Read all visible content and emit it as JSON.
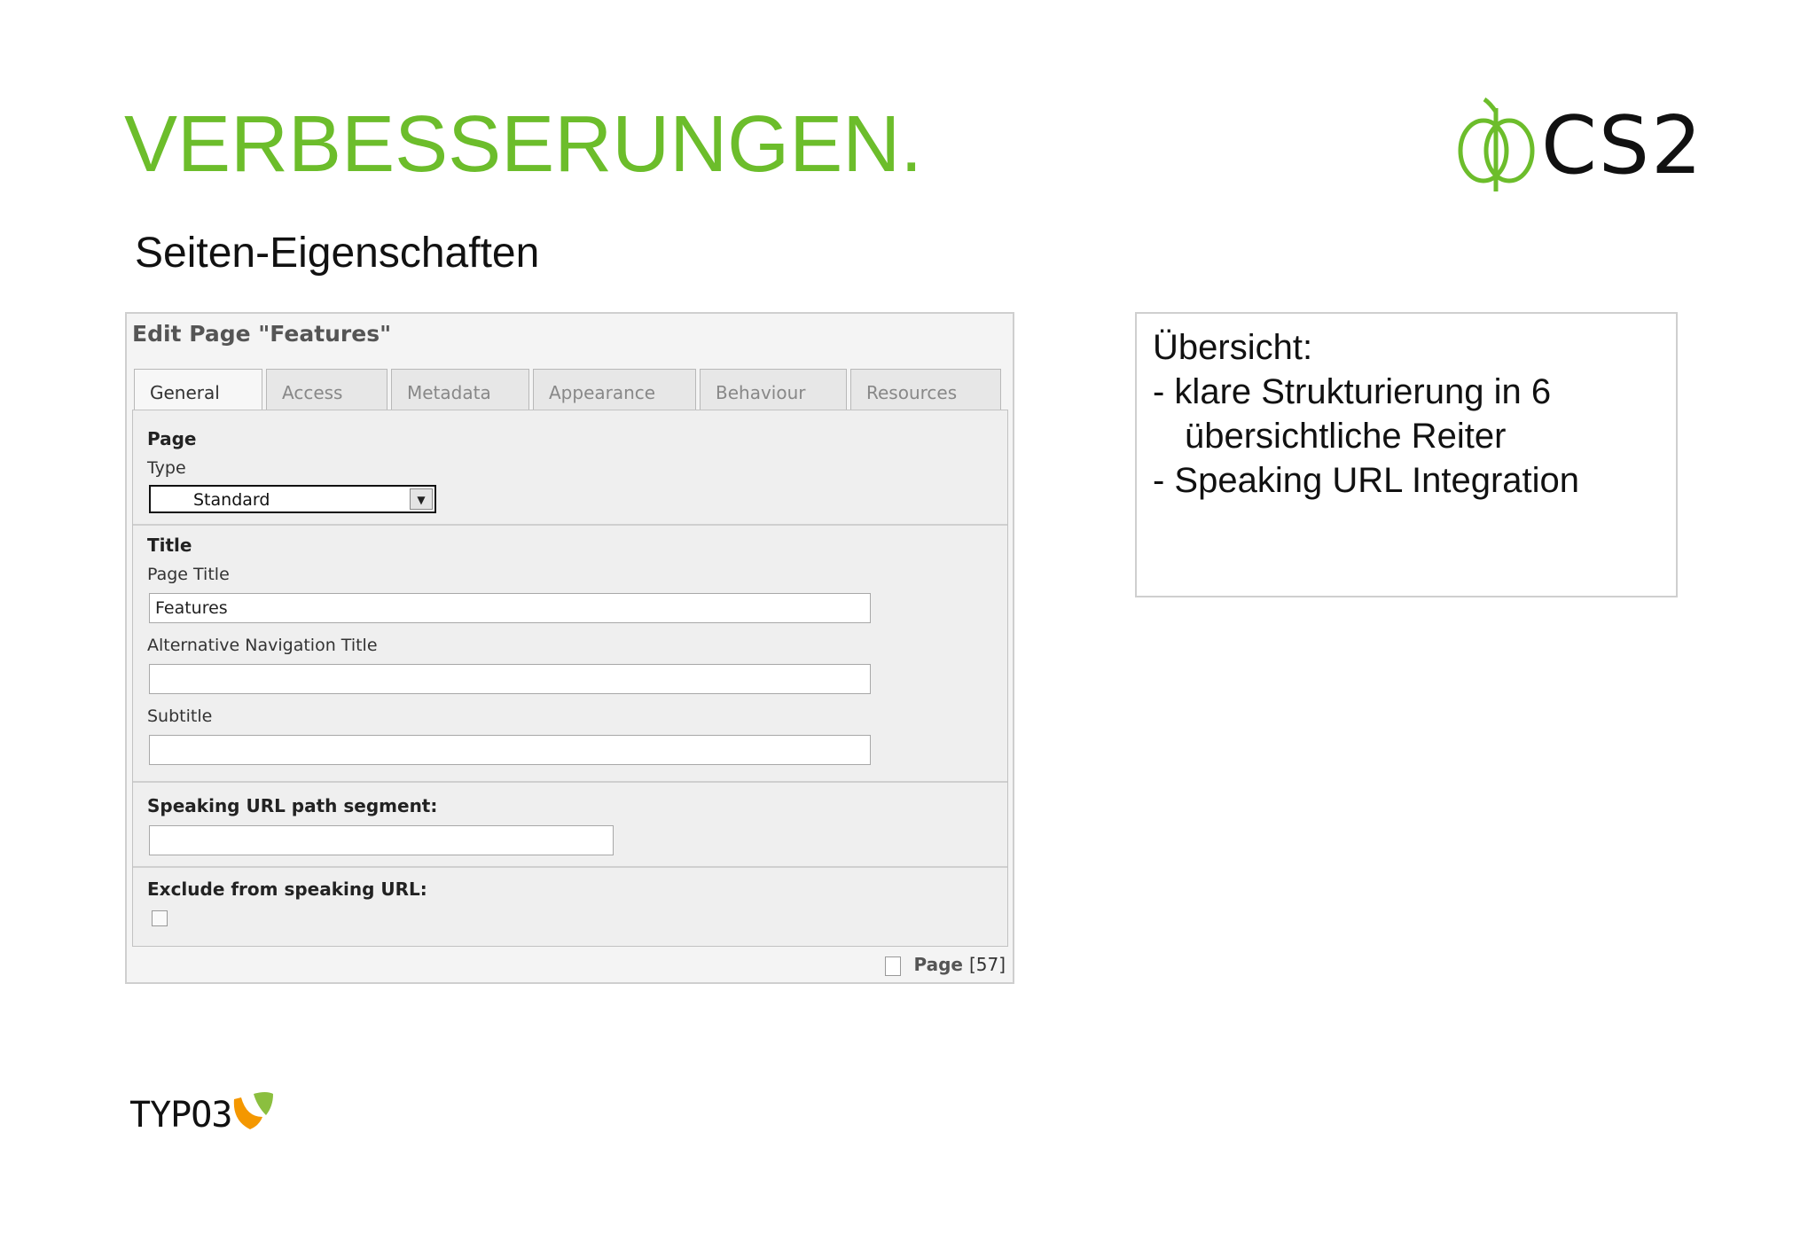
{
  "slide": {
    "title": "VERBESSERUNGEN.",
    "subtitle": "Seiten-Eigenschaften",
    "logo_text": "CS2",
    "footer_logo_text": "TYPO3"
  },
  "editor": {
    "header": "Edit Page \"Features\"",
    "tabs": [
      {
        "label": "General",
        "active": true
      },
      {
        "label": "Access",
        "active": false
      },
      {
        "label": "Metadata",
        "active": false
      },
      {
        "label": "Appearance",
        "active": false
      },
      {
        "label": "Behaviour",
        "active": false
      },
      {
        "label": "Resources",
        "active": false
      }
    ],
    "page_section": {
      "heading": "Page",
      "type_label": "Type",
      "type_value": "Standard"
    },
    "title_section": {
      "heading": "Title",
      "page_title_label": "Page Title",
      "page_title_value": "Features",
      "nav_title_label": "Alternative Navigation Title",
      "nav_title_value": "",
      "subtitle_label": "Subtitle",
      "subtitle_value": ""
    },
    "speaking_url": {
      "label": "Speaking URL path segment:",
      "value": ""
    },
    "exclude": {
      "label": "Exclude from speaking URL:",
      "checked": false
    },
    "footer": {
      "label": "Page",
      "id": "[57]"
    }
  },
  "overview": {
    "lines": [
      "Übersicht:",
      "- klare Strukturierung in 6",
      "übersichtliche Reiter",
      "- Speaking URL Integration"
    ]
  },
  "colors": {
    "accent_green": "#6cbd2b",
    "typo3_orange": "#f49700",
    "typo3_green": "#8bbf3f"
  }
}
